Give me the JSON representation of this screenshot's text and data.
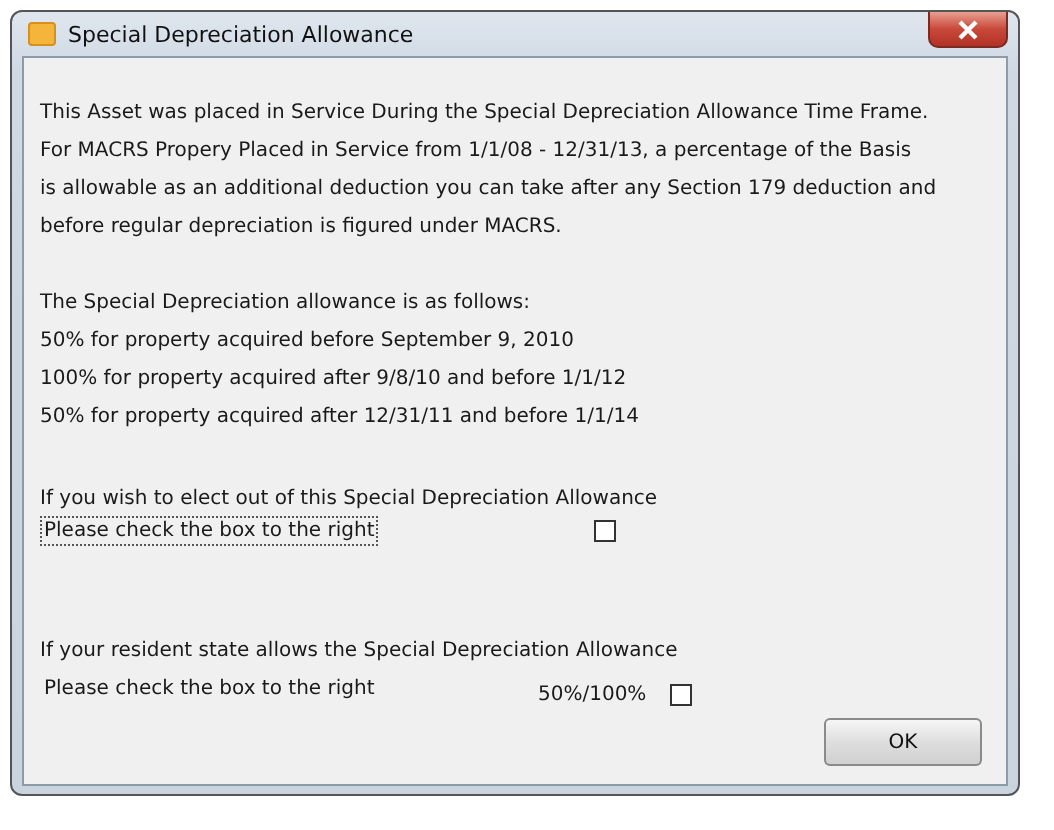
{
  "window": {
    "title": "Special Depreciation Allowance"
  },
  "intro": [
    "This Asset was placed in Service During the Special Depreciation Allowance Time Frame.",
    "For MACRS Propery Placed in Service from 1/1/08 - 12/31/13, a percentage of the Basis",
    "is allowable as an additional deduction you can take after any Section 179 deduction and",
    "before regular depreciation is figured under MACRS."
  ],
  "rates": [
    "The Special Depreciation allowance is as follows:",
    "50% for property acquired before September 9, 2010",
    "100% for property acquired after 9/8/10 and before 1/1/12",
    "50% for property acquired after 12/31/11 and before 1/1/14"
  ],
  "options": [
    {
      "kind": "elect_out",
      "prompt": "If you wish to elect out of this Special Depreciation Allowance",
      "label": "Please check the box to the right",
      "focused": true,
      "checked": false
    },
    {
      "kind": "state",
      "prompt": "If your resident state allows the Special Depreciation Allowance",
      "label": "Please check the box to the right",
      "caption": "50%/100%",
      "focused": false,
      "checked": false
    }
  ],
  "buttons": [
    {
      "label": "OK"
    }
  ]
}
